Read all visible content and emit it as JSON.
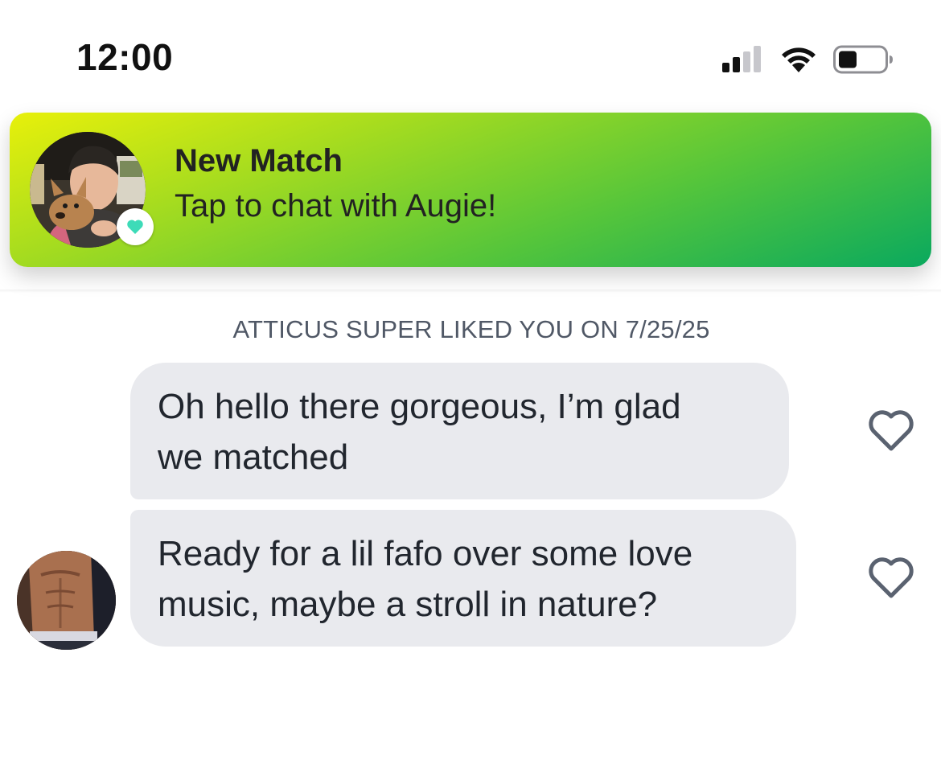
{
  "status_bar": {
    "time": "12:00",
    "icons": [
      "cellular-signal-icon",
      "wifi-icon",
      "battery-icon"
    ]
  },
  "banner": {
    "title": "New Match",
    "subtitle": "Tap to chat with Augie!",
    "badge_icon": "heart-icon",
    "colors": {
      "gradient_start": "#e8f00a",
      "gradient_end": "#0aa95e",
      "badge_heart": "#3ddbb8"
    }
  },
  "chat": {
    "super_like_notice": "ATTICUS SUPER LIKED YOU ON 7/25/25",
    "messages": [
      {
        "line1": "Oh hello there gorgeous, I’m glad",
        "line2": "we matched",
        "liked": false
      },
      {
        "line1": "Ready for a lil fafo over some love",
        "line2": "music, maybe a stroll in nature?",
        "liked": false
      }
    ]
  }
}
